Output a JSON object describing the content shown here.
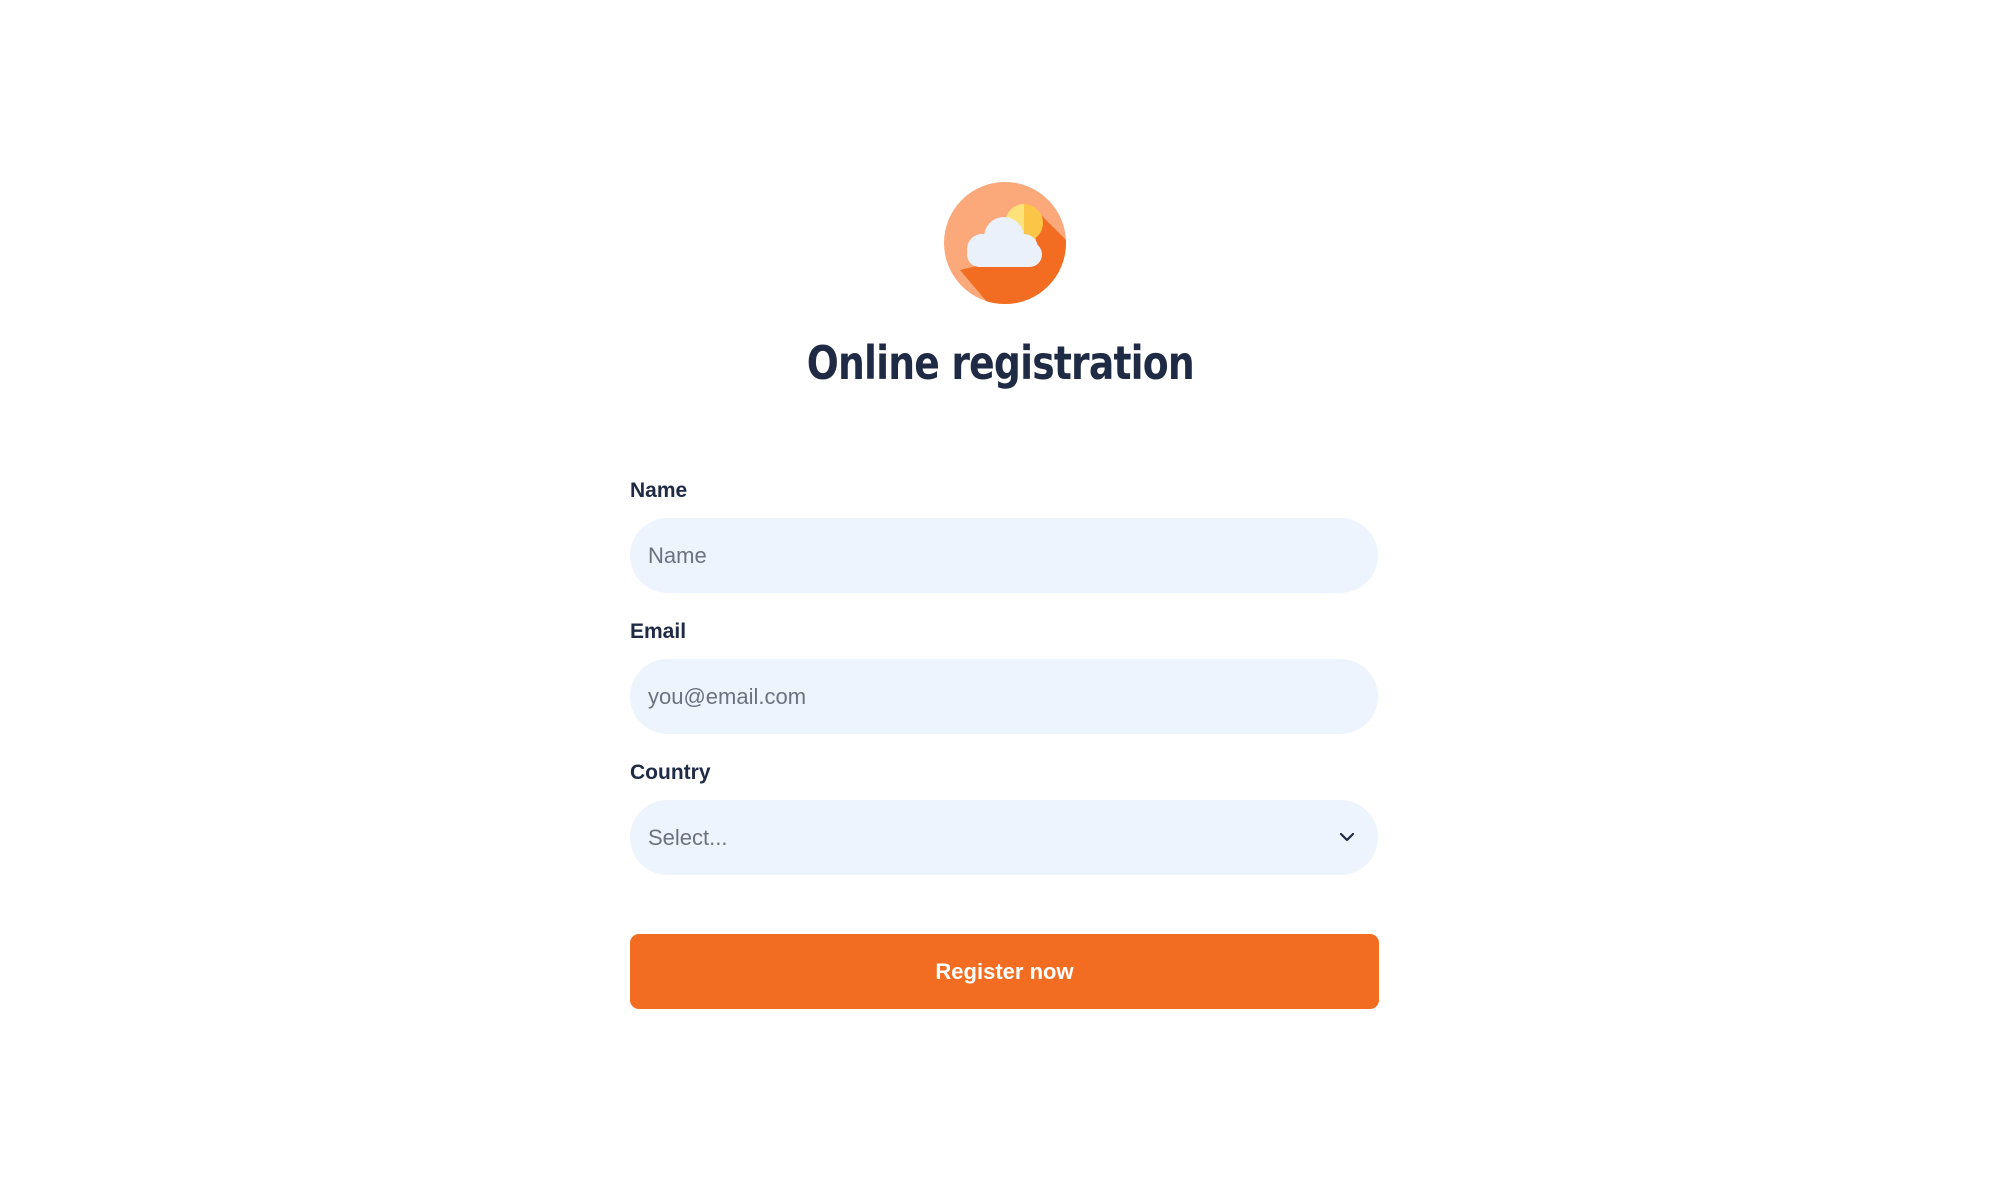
{
  "page": {
    "title": "Online registration"
  },
  "logo": {
    "icon": "cloud-sun-icon",
    "colors": {
      "circle": "#fba87a",
      "shadow": "#f26c21",
      "sun": "#fbd86a",
      "cloud": "#eaf1fb"
    }
  },
  "form": {
    "name": {
      "label": "Name",
      "placeholder": "Name",
      "value": ""
    },
    "email": {
      "label": "Email",
      "placeholder": "you@email.com",
      "value": ""
    },
    "country": {
      "label": "Country",
      "selected": "Select...",
      "icon": "chevron-down-icon"
    },
    "submit_label": "Register now"
  },
  "colors": {
    "accent": "#f26c21",
    "field_bg": "#eef4fd",
    "text": "#1f2a44",
    "placeholder": "#6b7280"
  }
}
